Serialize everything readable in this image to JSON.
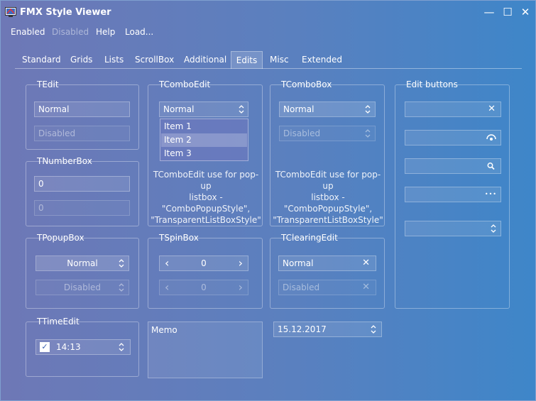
{
  "window": {
    "title": "FMX Style Viewer",
    "minimize": "—",
    "maximize": "☐",
    "close": "✕"
  },
  "menu": {
    "enabled": "Enabled",
    "disabled": "Disabled",
    "help": "Help",
    "load": "Load..."
  },
  "tabs": [
    "Standard",
    "Grids",
    "Lists",
    "ScrollBox",
    "Additional",
    "Edits",
    "Misc",
    "Extended"
  ],
  "active_tab": "Edits",
  "tedit": {
    "title": "TEdit",
    "normal": "Normal",
    "disabled": "Disabled"
  },
  "tnumberbox": {
    "title": "TNumberBox",
    "v1": "0",
    "v2": "0"
  },
  "tcomboedit": {
    "title": "TComboEdit",
    "value": "Normal",
    "items": [
      "Item 1",
      "Item 2",
      "Item 3"
    ],
    "selected_index": 1,
    "caption": [
      "TComboEdit use for pop-up",
      "listbox -",
      "\"ComboPopupStyle\",",
      "\"TransparentListBoxStyle\""
    ]
  },
  "tcombobox": {
    "title": "TComboBox",
    "normal": "Normal",
    "disabled": "Disabled",
    "caption": [
      "TComboEdit use for pop-up",
      "listbox -",
      "\"ComboPopupStyle\",",
      "\"TransparentListBoxStyle\""
    ]
  },
  "editbuttons": {
    "title": "Edit buttons"
  },
  "tpopupbox": {
    "title": "TPopupBox",
    "normal": "Normal",
    "disabled": "Disabled"
  },
  "tspinbox": {
    "title": "TSpinBox",
    "v1": "0",
    "v2": "0",
    "left": "‹",
    "right": "›"
  },
  "tclearingedit": {
    "title": "TClearingEdit",
    "normal": "Normal",
    "disabled": "Disabled"
  },
  "ttimeedit": {
    "title": "TTimeEdit",
    "time": "14:13",
    "checked": true,
    "check": "✓"
  },
  "memo": {
    "text": "Memo"
  },
  "dateedit": {
    "value": "15.12.2017"
  },
  "icons": {
    "clear": "✕",
    "ellipsis": "•••",
    "updown": "⌃⌄"
  }
}
